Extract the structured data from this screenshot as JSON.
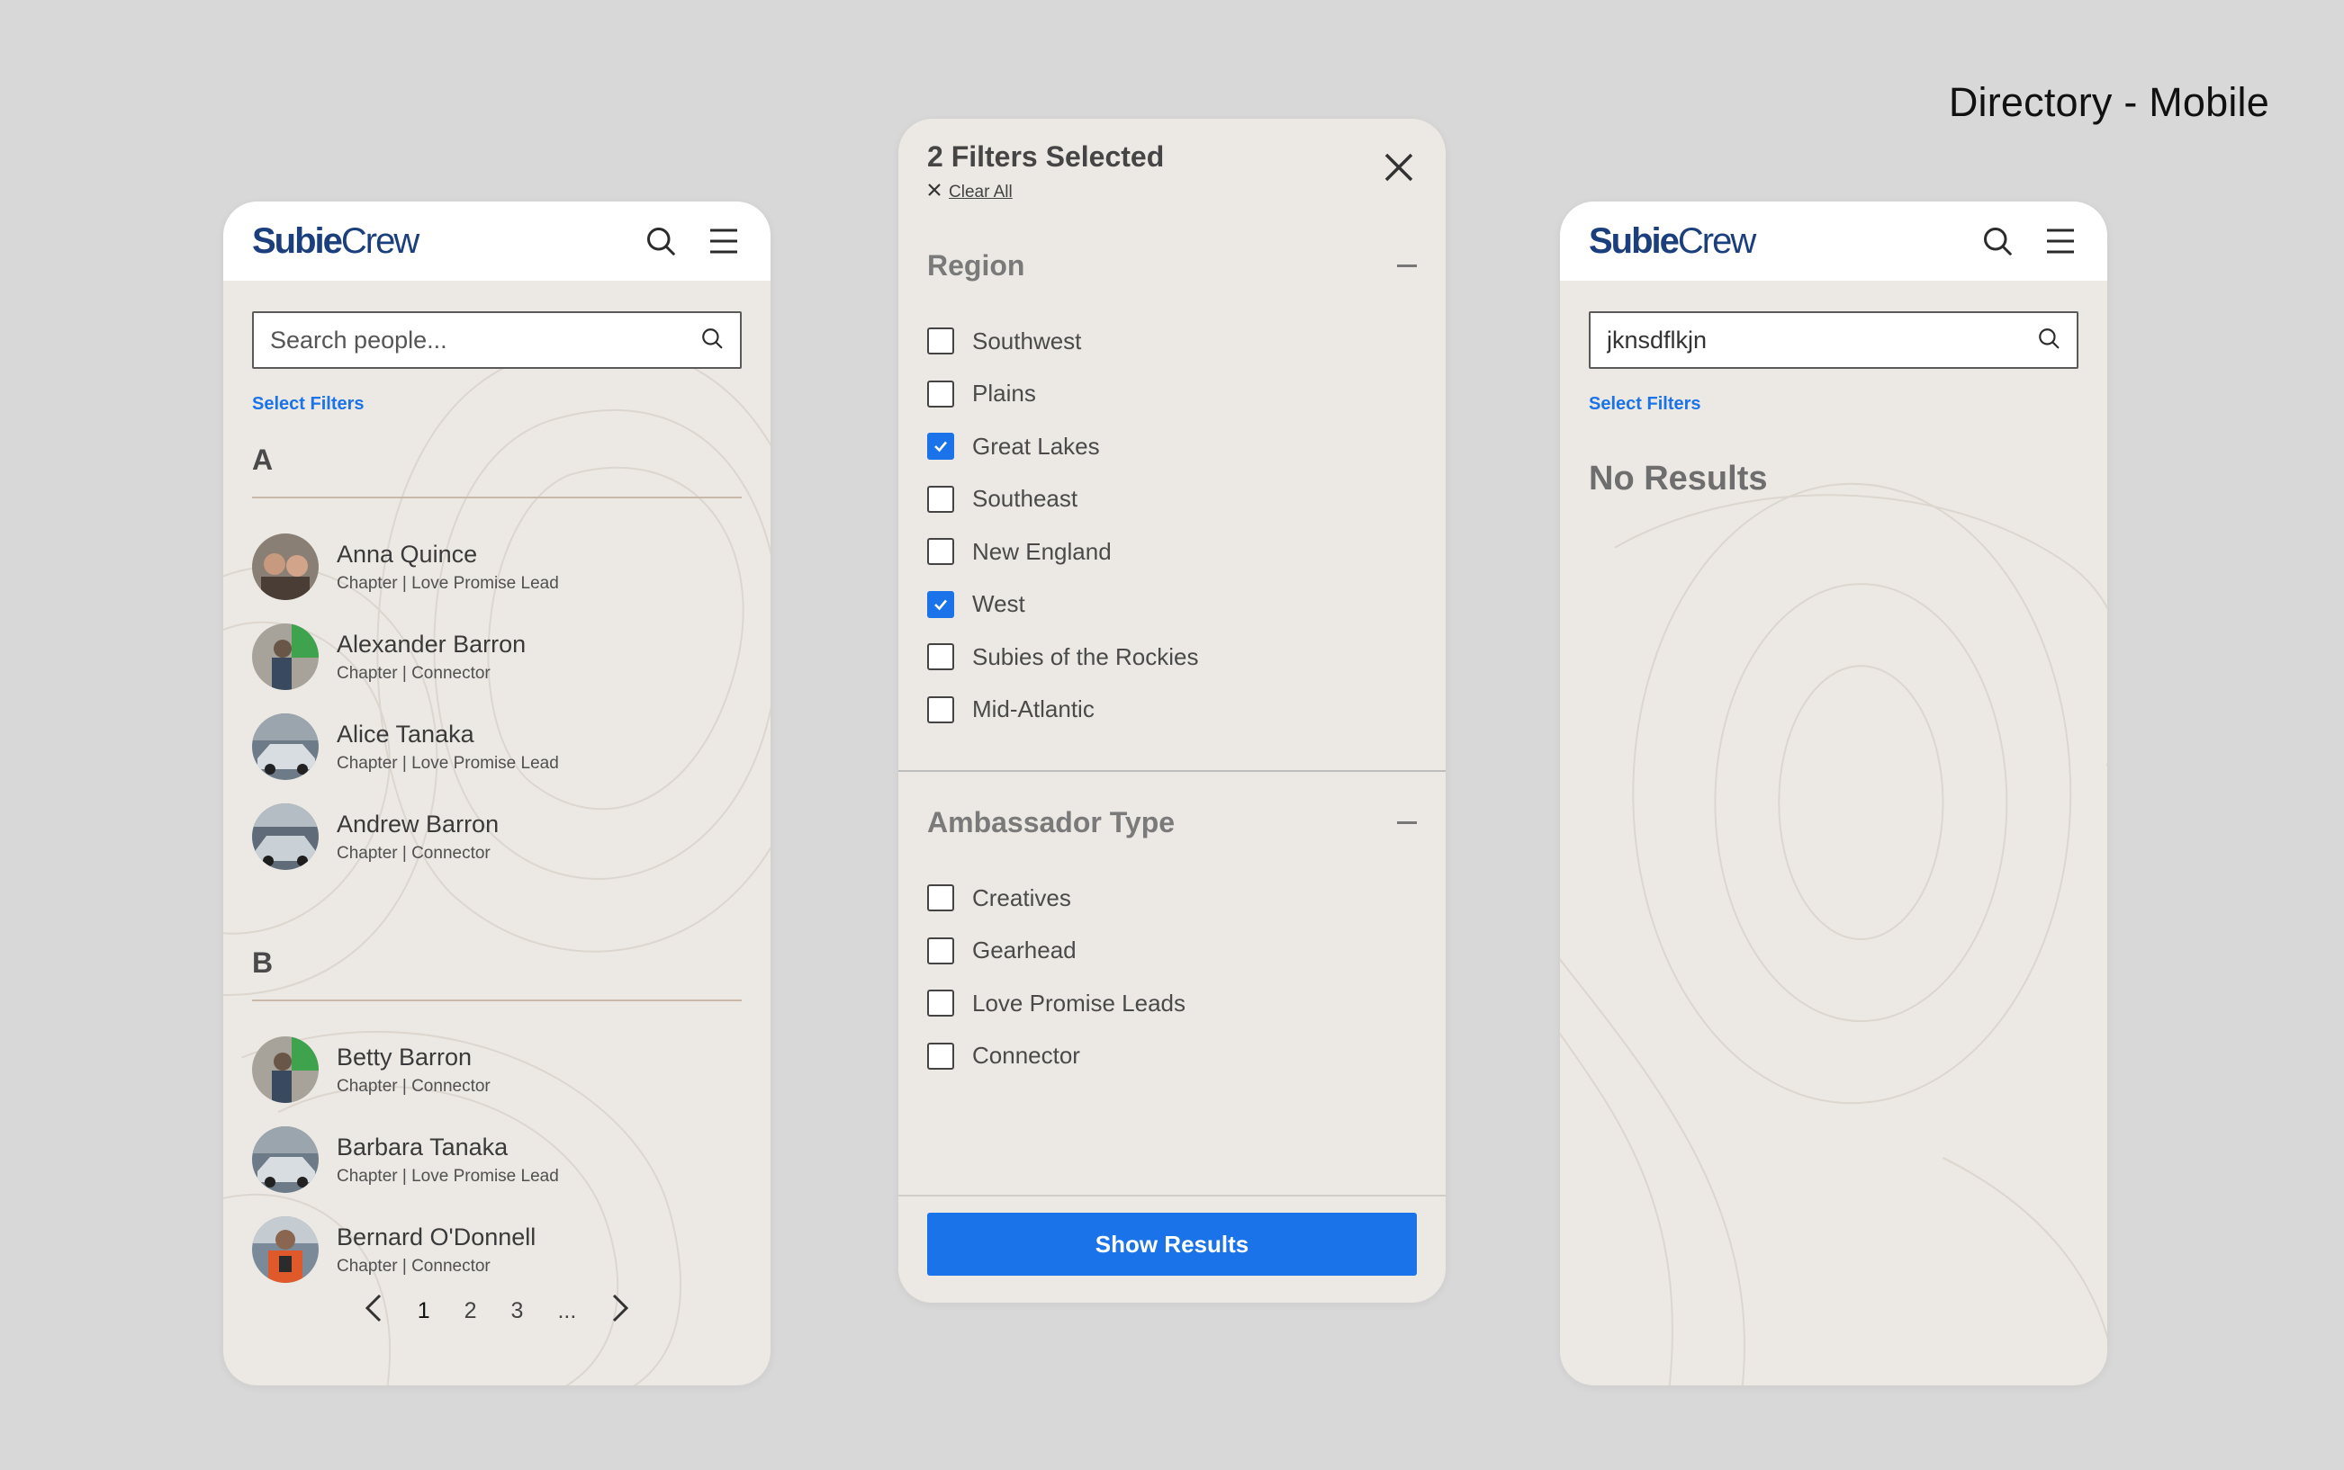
{
  "page": {
    "heading": "Directory - Mobile"
  },
  "brand": {
    "logo_bold": "Subie",
    "logo_light": "Crew",
    "color": "#1b3f7d"
  },
  "accent": "#1a73e8",
  "directory": {
    "search_placeholder": "Search people...",
    "select_filters": "Select Filters",
    "groups": [
      {
        "letter": "A",
        "people": [
          {
            "name": "Anna Quince",
            "role": "Chapter | Love Promise Lead"
          },
          {
            "name": "Alexander Barron",
            "role": "Chapter | Connector"
          },
          {
            "name": "Alice Tanaka",
            "role": "Chapter | Love Promise Lead"
          },
          {
            "name": "Andrew Barron",
            "role": "Chapter | Connector"
          }
        ]
      },
      {
        "letter": "B",
        "people": [
          {
            "name": "Betty Barron",
            "role": "Chapter | Connector"
          },
          {
            "name": "Barbara Tanaka",
            "role": "Chapter | Love Promise Lead"
          },
          {
            "name": "Bernard O'Donnell",
            "role": "Chapter | Connector"
          }
        ]
      }
    ],
    "pagination": {
      "pages": [
        "1",
        "2",
        "3",
        "..."
      ],
      "current": "1"
    }
  },
  "filters": {
    "title": "2 Filters Selected",
    "clear_all": "Clear All",
    "sections": [
      {
        "title": "Region",
        "options": [
          {
            "label": "Southwest",
            "checked": false
          },
          {
            "label": "Plains",
            "checked": false
          },
          {
            "label": "Great Lakes",
            "checked": true
          },
          {
            "label": "Southeast",
            "checked": false
          },
          {
            "label": "New England",
            "checked": false
          },
          {
            "label": "West",
            "checked": true
          },
          {
            "label": "Subies of the Rockies",
            "checked": false
          },
          {
            "label": "Mid-Atlantic",
            "checked": false
          }
        ]
      },
      {
        "title": "Ambassador Type",
        "options": [
          {
            "label": "Creatives",
            "checked": false
          },
          {
            "label": "Gearhead",
            "checked": false
          },
          {
            "label": "Love Promise Leads",
            "checked": false
          },
          {
            "label": "Connector",
            "checked": false
          }
        ]
      }
    ],
    "show_results": "Show Results"
  },
  "search_results": {
    "query": "jknsdflkjn",
    "select_filters": "Select Filters",
    "no_results": "No Results"
  }
}
